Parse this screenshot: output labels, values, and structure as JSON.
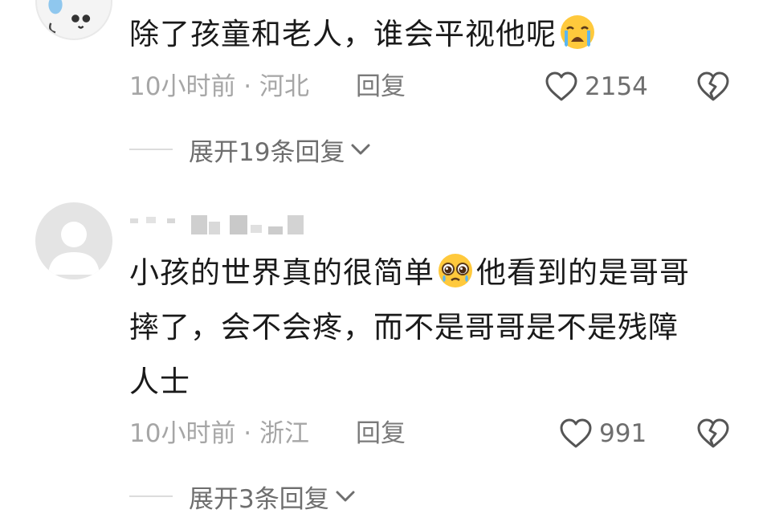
{
  "comments": [
    {
      "avatar_icon": "cartoon-avatar-icon",
      "text": "除了孩童和老人，谁会平视他呢",
      "emoji_icon": "loudly-crying-face-icon",
      "time": "10小时前",
      "separator": " · ",
      "location": "河北",
      "reply_label": "回复",
      "like_count": "2154",
      "expand_label": "展开19条回复"
    },
    {
      "avatar_icon": "default-user-avatar-icon",
      "text_before_emoji": "小孩的世界真的很简单",
      "emoji_icon": "pleading-face-icon",
      "text_after_emoji": "他看到的是哥哥\n摔了，会不会疼，而不是哥哥是不是残障\n人士",
      "time": "10小时前",
      "separator": " · ",
      "location": "浙江",
      "reply_label": "回复",
      "like_count": "991",
      "expand_label": "展开3条回复"
    }
  ],
  "colors": {
    "text_primary": "#1a1a1a",
    "text_meta": "#a6a6a6",
    "text_action": "#6e6e6e",
    "divider": "#dcdcdc"
  }
}
